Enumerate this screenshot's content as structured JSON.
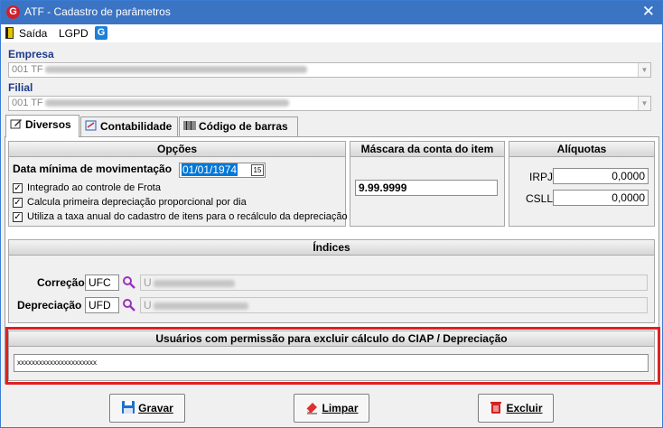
{
  "window": {
    "title": "ATF - Cadastro de parâmetros",
    "app_icon": "G",
    "close_glyph": "✕"
  },
  "menu": {
    "items": [
      "Saída",
      "LGPD"
    ],
    "gen_icon": "G"
  },
  "empresa": {
    "label": "Empresa",
    "value": "001 TF"
  },
  "filial": {
    "label": "Filial",
    "value": "001 TF"
  },
  "tabs": [
    {
      "label": "Diversos",
      "icon": "edit-icon",
      "active": true
    },
    {
      "label": "Contabilidade",
      "icon": "ledger-icon",
      "active": false
    },
    {
      "label": "Código de barras",
      "icon": "barcode-icon",
      "active": false
    }
  ],
  "opcoes": {
    "title": "Opções",
    "date_label": "Data mínima de movimentação",
    "date_value": "01/01/1974",
    "calendar_glyph": "15",
    "checks": [
      {
        "label": "Integrado ao controle de Frota",
        "checked": true
      },
      {
        "label": "Calcula primeira depreciação proporcional por dia",
        "checked": true
      },
      {
        "label": "Utiliza a taxa anual do cadastro de itens para o recálculo da depreciação",
        "checked": true
      }
    ]
  },
  "mascara": {
    "title": "Máscara da conta do item",
    "value": "9.99.9999"
  },
  "aliquotas": {
    "title": "Alíquotas",
    "irpj_label": "IRPJ",
    "irpj_value": "0,0000",
    "csll_label": "CSLL",
    "csll_value": "0,0000"
  },
  "indices": {
    "title": "Índices",
    "correcao_label": "Correção",
    "correcao_code": "UFC",
    "correcao_desc": "U",
    "depreciacao_label": "Depreciação",
    "depreciacao_code": "UFD",
    "depreciacao_desc": "U"
  },
  "usuarios": {
    "title": "Usuários com permissão para excluir cálculo do CIAP / Depreciação",
    "value": "xxxxxxxxxxxxxxxxxxxxxx"
  },
  "buttons": {
    "gravar": "Gravar",
    "limpar": "Limpar",
    "excluir": "Excluir"
  },
  "colors": {
    "titlebar": "#3c74c4",
    "label_blue": "#1f3c8a",
    "highlight": "#e02020",
    "date_selection": "#0078d7"
  }
}
